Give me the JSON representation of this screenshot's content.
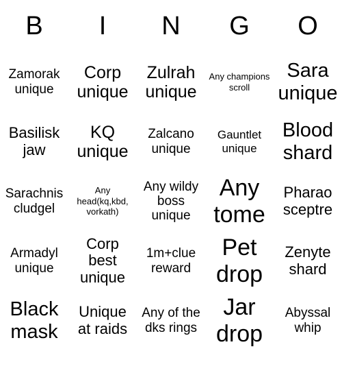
{
  "title": "BINGO",
  "theme": {
    "background": "#ffffff",
    "text_color": "#000000"
  },
  "header": {
    "letters": [
      "B",
      "I",
      "N",
      "G",
      "O"
    ]
  },
  "board": {
    "columns": 5,
    "rows": 5,
    "cells": [
      {
        "text": "Zamorak unique",
        "size": "s-md"
      },
      {
        "text": "Corp unique",
        "size": "s-xl"
      },
      {
        "text": "Zulrah unique",
        "size": "s-xl"
      },
      {
        "text": "Any champions scroll",
        "size": "s-xs"
      },
      {
        "text": "Sara unique",
        "size": "s-xxl"
      },
      {
        "text": "Basilisk jaw",
        "size": "s-lg"
      },
      {
        "text": "KQ unique",
        "size": "s-xl"
      },
      {
        "text": "Zalcano unique",
        "size": "s-md"
      },
      {
        "text": "Gauntlet unique",
        "size": "s-sm"
      },
      {
        "text": "Blood shard",
        "size": "s-xxl"
      },
      {
        "text": "Sarachnis cludgel",
        "size": "s-md"
      },
      {
        "text": "Any head(kq,kbd, vorkath)",
        "size": "s-xs"
      },
      {
        "text": "Any wildy boss unique",
        "size": "s-md"
      },
      {
        "text": "Any tome",
        "size": "s-max"
      },
      {
        "text": "Pharao sceptre",
        "size": "s-lg"
      },
      {
        "text": "Armadyl unique",
        "size": "s-md"
      },
      {
        "text": "Corp best unique",
        "size": "s-lg"
      },
      {
        "text": "1m+clue reward",
        "size": "s-md"
      },
      {
        "text": "Pet drop",
        "size": "s-max"
      },
      {
        "text": "Zenyte shard",
        "size": "s-lg"
      },
      {
        "text": "Black mask",
        "size": "s-xxl"
      },
      {
        "text": "Unique at raids",
        "size": "s-lg"
      },
      {
        "text": "Any of the dks rings",
        "size": "s-md"
      },
      {
        "text": "Jar drop",
        "size": "s-max"
      },
      {
        "text": "Abyssal whip",
        "size": "s-md"
      }
    ]
  }
}
